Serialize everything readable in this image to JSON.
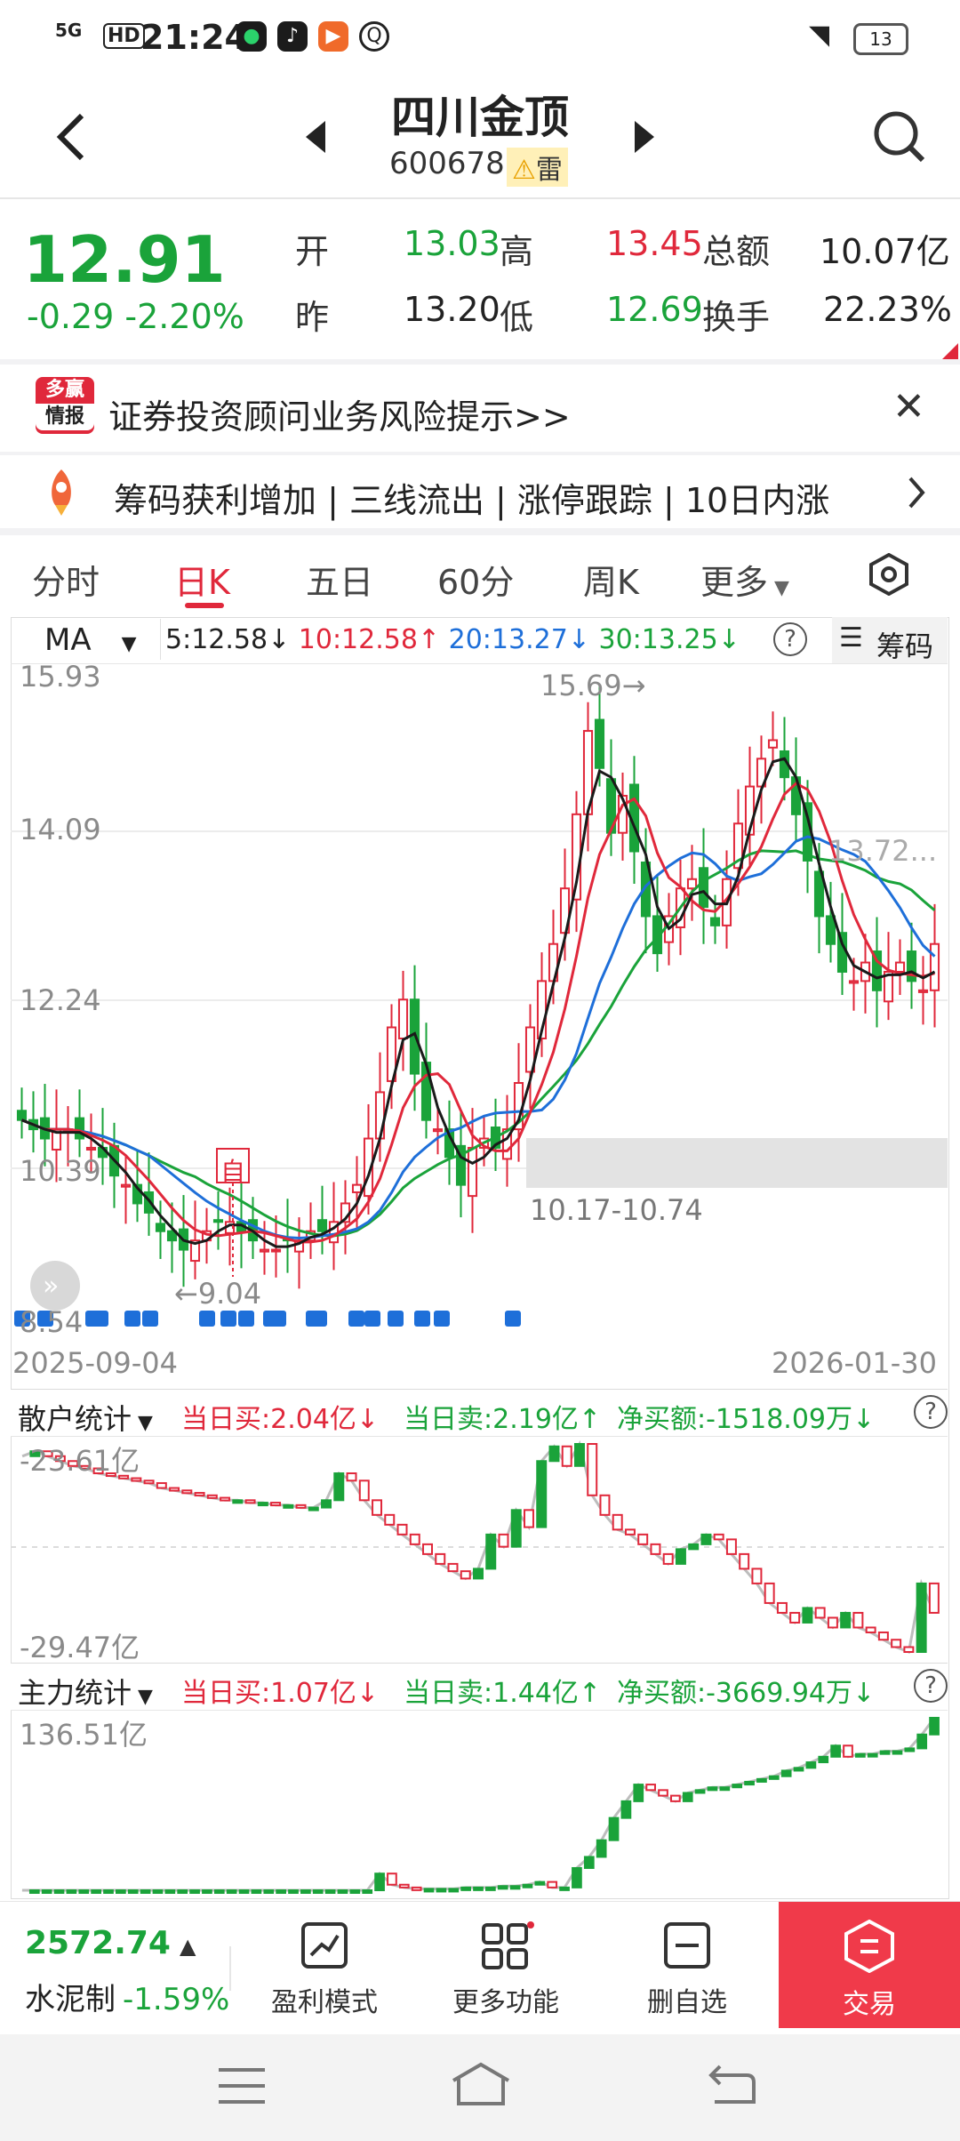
{
  "status_bar": {
    "signal": "5G",
    "hd": "HD",
    "time": "21:24",
    "battery": "13"
  },
  "header": {
    "title": "四川金顶",
    "code": "600678",
    "badge": "雷"
  },
  "quote": {
    "price": "12.91",
    "change": "-0.29",
    "change_pct": "-2.20%",
    "open_label": "开",
    "open": "13.03",
    "high_label": "高",
    "high": "13.45",
    "amount_label": "总额",
    "amount": "10.07亿",
    "prev_label": "昨",
    "prev": "13.20",
    "low_label": "低",
    "low": "12.69",
    "turnover_label": "换手",
    "turnover": "22.23%"
  },
  "banner": {
    "logo_top": "多赢",
    "logo_bottom": "情报",
    "text": "证券投资顾问业务风险提示>>"
  },
  "ticker": {
    "text": "筹码获利增加 | 三线流出 | 涨停跟踪 | 10日内涨"
  },
  "tabs": [
    "分时",
    "日K",
    "五日",
    "60分",
    "周K",
    "更多"
  ],
  "chart": {
    "indicator": "MA",
    "ma5": "5:12.58↓",
    "ma10": "10:12.58↑",
    "ma20": "20:13.27↓",
    "ma30": "30:13.25↓",
    "chips_label": "筹码",
    "y_labels": [
      "15.93",
      "14.09",
      "12.24",
      "10.39",
      "8.54"
    ],
    "max_label": "15.69",
    "min_label": "9.04",
    "zone_label": "10.17-10.74",
    "last_label": "13.72...",
    "marker": "自",
    "date_start": "2025-09-04",
    "date_end": "2026-01-30",
    "colors": {
      "ma5": "#1a1a1a",
      "ma10": "#e0283b",
      "ma20": "#1e6fd9",
      "ma30": "#1aa33a",
      "up": "#e0283b",
      "down": "#1aa33a"
    }
  },
  "chart_data": {
    "type": "line",
    "x": [
      "2025-09-04",
      "2026-01-30"
    ],
    "series": [
      {
        "name": "5",
        "values": [
          12.58
        ]
      },
      {
        "name": "10",
        "values": [
          12.58
        ]
      },
      {
        "name": "20",
        "values": [
          13.27
        ]
      },
      {
        "name": "30",
        "values": [
          13.25
        ]
      }
    ],
    "ylim": [
      8.54,
      15.93
    ],
    "y_ticks": [
      "15.93",
      "14.09",
      "12.24",
      "10.39",
      "8.54"
    ]
  },
  "retail": {
    "label": "散户统计",
    "buy": "当日买:2.04亿↓",
    "sell": "当日卖:2.19亿↑",
    "net": "净买额:-1518.09万↓",
    "top": "-23.61亿",
    "bottom": "-29.47亿"
  },
  "main_force": {
    "label": "主力统计",
    "buy": "当日买:1.07亿↓",
    "sell": "当日卖:1.44亿↑",
    "net": "净买额:-3669.94万↓",
    "top": "136.51亿"
  },
  "bottom": {
    "index_value": "2572.74",
    "index_name": "水泥制",
    "index_change": "-1.59%",
    "items": [
      "盈利模式",
      "更多功能",
      "删自选",
      "交易"
    ]
  }
}
